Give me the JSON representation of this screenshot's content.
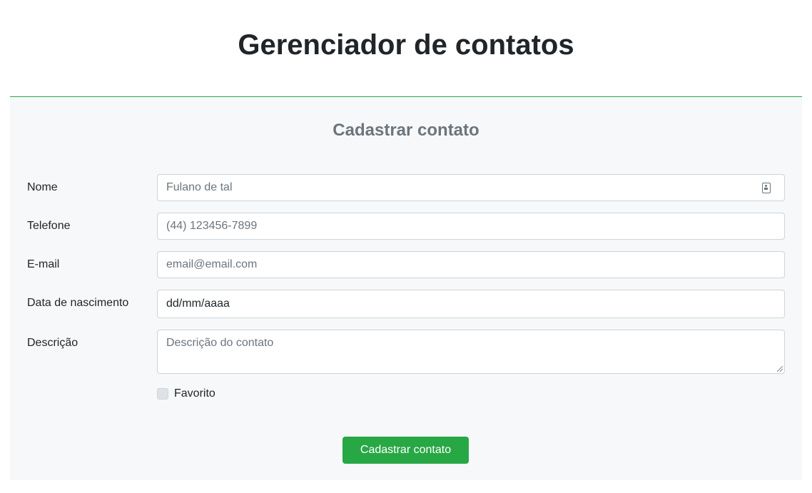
{
  "header": {
    "title": "Gerenciador de contatos"
  },
  "form": {
    "title": "Cadastrar contato",
    "fields": {
      "nome": {
        "label": "Nome",
        "placeholder": "Fulano de tal",
        "icon": "contact-card-icon"
      },
      "telefone": {
        "label": "Telefone",
        "placeholder": "(44) 123456-7899"
      },
      "email": {
        "label": "E-mail",
        "placeholder": "email@email.com"
      },
      "nascimento": {
        "label": "Data de nascimento",
        "value": "dd/mm/aaaa"
      },
      "descricao": {
        "label": "Descrição",
        "placeholder": "Descrição do contato"
      }
    },
    "favorito": {
      "label": "Favorito",
      "checked": false
    },
    "submit_label": "Cadastrar contato"
  },
  "colors": {
    "accent": "#28a745",
    "panel_background": "#f7f8f9",
    "section_title": "#6c757d"
  }
}
